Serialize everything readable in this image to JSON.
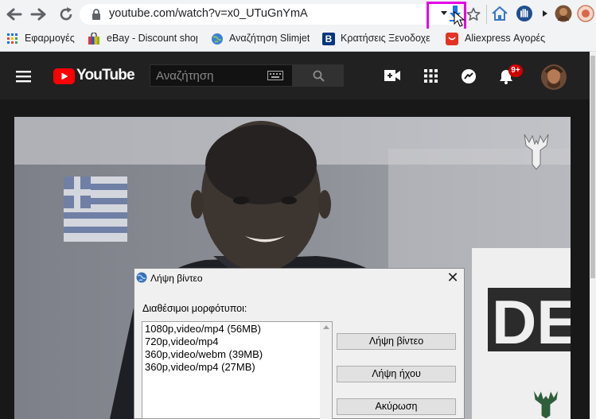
{
  "browser": {
    "url": "youtube.com/watch?v=x0_UTuGnYmA",
    "bookmarks": [
      {
        "label": "Εφαρμογές"
      },
      {
        "label": "eBay - Discount shop"
      },
      {
        "label": "Αναζήτηση Slimjet"
      },
      {
        "label": "Κρατήσεις Ξενοδοχεί"
      },
      {
        "label": "Aliexpress Αγορές"
      }
    ]
  },
  "youtube": {
    "logo_text": "YouTube",
    "search_placeholder": "Αναζήτηση",
    "notification_count": "9+"
  },
  "dialog": {
    "title": "Λήψη βίντεο",
    "formats_label": "Διαθέσιμοι μορφότυποι:",
    "formats": [
      "1080p,video/mp4 (56MB)",
      "720p,video/mp4",
      "360p,video/webm (39MB)",
      "360p,video/mp4 (27MB)"
    ],
    "download_video": "Λήψη βίντεο",
    "download_audio": "Λήψη ήχου",
    "cancel": "Ακύρωση"
  },
  "colors": {
    "highlight": "#e600e6",
    "youtube_red": "#ff0000",
    "download_icon": "#1a73e8",
    "badge": "#cc0000"
  }
}
